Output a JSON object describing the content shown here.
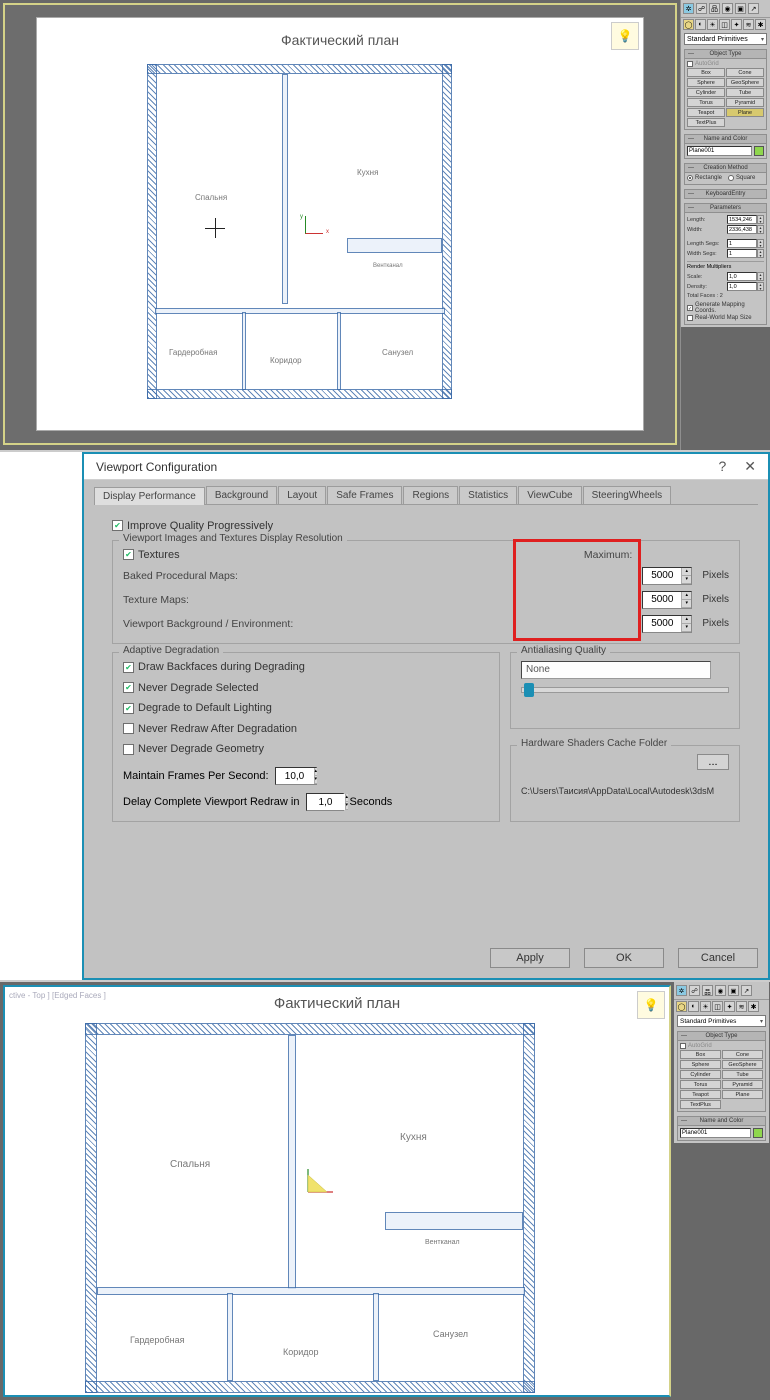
{
  "floorplan": {
    "title": "Фактический план",
    "rooms": {
      "bedroom": "Спальня",
      "kitchen": "Кухня",
      "wardrobe": "Гардеробная",
      "corridor": "Коридор",
      "bathroom": "Санузел",
      "vent": "Вентканал"
    }
  },
  "cmd": {
    "dropdown": "Standard Primitives",
    "object_type": {
      "header": "Object Type",
      "autogrid": "AutoGrid",
      "buttons": [
        "Box",
        "Cone",
        "Sphere",
        "GeoSphere",
        "Cylinder",
        "Tube",
        "Torus",
        "Pyramid",
        "Teapot",
        "Plane",
        "TextPlus"
      ],
      "selected": "Plane"
    },
    "name_color": {
      "header": "Name and Color",
      "name": "Plane001"
    },
    "creation": {
      "header": "Creation Method",
      "rectangle": "Rectangle",
      "square": "Square"
    },
    "keyboard": {
      "header": "KeyboardEntry"
    },
    "params": {
      "header": "Parameters",
      "length_label": "Length:",
      "length": "1534,246",
      "width_label": "Width:",
      "width": "2336,438",
      "lsegs_label": "Length Segs:",
      "lsegs": "1",
      "wsegs_label": "Width Segs:",
      "wsegs": "1",
      "rmult": "Render Multipliers",
      "scale_label": "Scale:",
      "scale": "1,0",
      "density_label": "Density:",
      "density": "1,0",
      "faces": "Total Faces : 2",
      "genmap": "Generate Mapping Coords.",
      "realworld": "Real-World Map Size"
    }
  },
  "dialog": {
    "title": "Viewport Configuration",
    "tabs": [
      "Display Performance",
      "Background",
      "Layout",
      "Safe Frames",
      "Regions",
      "Statistics",
      "ViewCube",
      "SteeringWheels"
    ],
    "improve": "Improve Quality Progressively",
    "res_group": "Viewport Images and Textures Display Resolution",
    "textures_ck": "Textures",
    "max_label": "Maximum:",
    "rows": {
      "baked": "Baked Procedural Maps:",
      "texmaps": "Texture Maps:",
      "bg": "Viewport Background / Environment:"
    },
    "values": {
      "baked": "5000",
      "texmaps": "5000",
      "bg": "5000"
    },
    "pixels": "Pixels",
    "adaptive": {
      "header": "Adaptive Degradation",
      "draw_back": "Draw Backfaces during Degrading",
      "never_sel": "Never Degrade Selected",
      "def_light": "Degrade to Default Lighting",
      "never_redraw": "Never Redraw After Degradation",
      "never_geom": "Never Degrade Geometry",
      "maintain": "Maintain Frames Per Second:",
      "fps": "10,0",
      "delay": "Delay Complete Viewport Redraw in",
      "delay_val": "1,0",
      "seconds": "Seconds"
    },
    "aa": {
      "header": "Antialiasing Quality",
      "value": "None"
    },
    "cache": {
      "header": "Hardware Shaders Cache Folder",
      "btn": "...",
      "path": "C:\\Users\\Таисия\\AppData\\Local\\Autodesk\\3dsM"
    },
    "buttons": {
      "apply": "Apply",
      "ok": "OK",
      "cancel": "Cancel"
    }
  },
  "bot_viewport_label": "ctive - Top ] [Edged Faces ]"
}
